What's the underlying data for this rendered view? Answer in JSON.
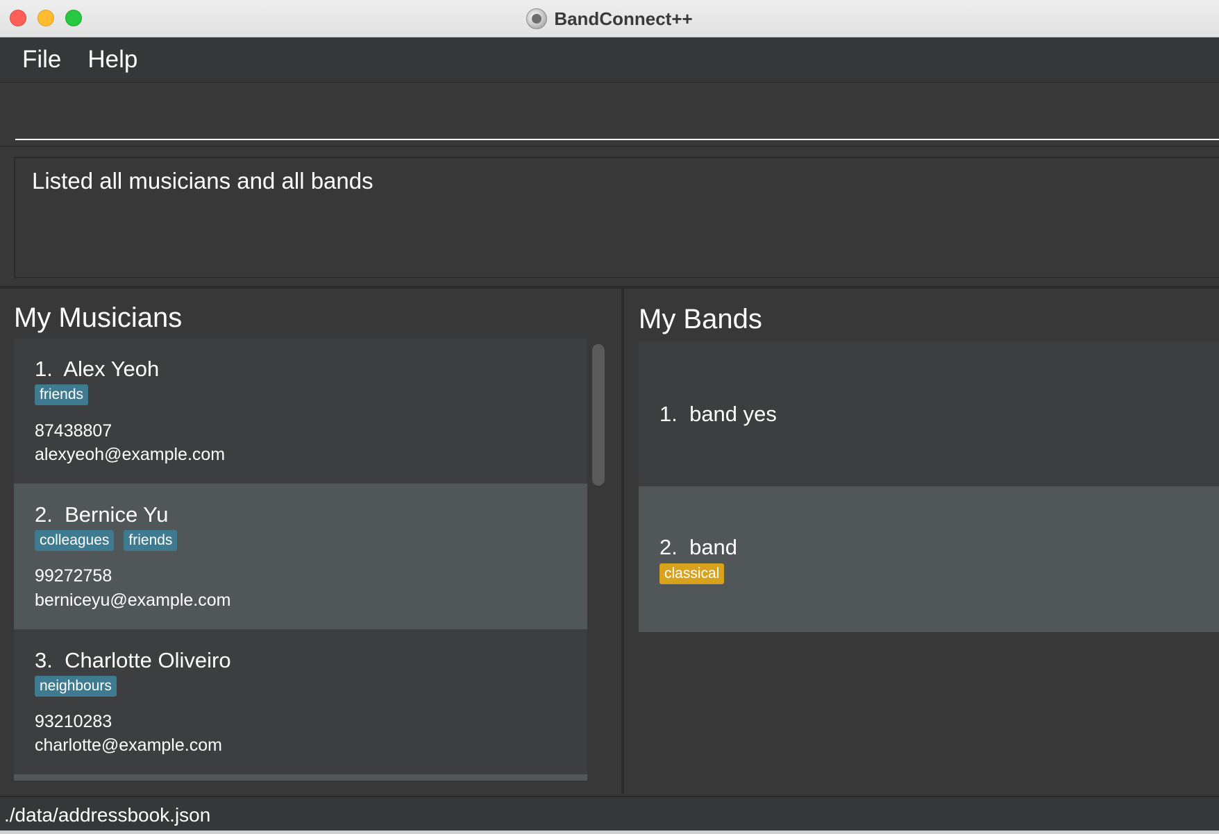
{
  "window": {
    "title": "BandConnect++"
  },
  "menu": {
    "file": "File",
    "help": "Help"
  },
  "command": {
    "value": ""
  },
  "result": {
    "message": "Listed all musicians and all bands"
  },
  "musicians": {
    "title": "My Musicians",
    "items": [
      {
        "name": "1.  Alex Yeoh",
        "tags": [
          "friends"
        ],
        "phone": "87438807",
        "email": "alexyeoh@example.com"
      },
      {
        "name": "2.  Bernice Yu",
        "tags": [
          "colleagues",
          "friends"
        ],
        "phone": "99272758",
        "email": "berniceyu@example.com"
      },
      {
        "name": "3.  Charlotte Oliveiro",
        "tags": [
          "neighbours"
        ],
        "phone": "93210283",
        "email": "charlotte@example.com"
      }
    ]
  },
  "bands": {
    "title": "My Bands",
    "items": [
      {
        "name": "1.  band yes",
        "tags": []
      },
      {
        "name": "2.  band",
        "tags": [
          "classical"
        ]
      }
    ]
  },
  "status": {
    "path": "./data/addressbook.json"
  },
  "colors": {
    "background": "#383838",
    "card_odd": "#3c3e3f",
    "card_even": "#515658",
    "musician_tag": "#3e7b91",
    "band_tag": "#d8a21d"
  }
}
